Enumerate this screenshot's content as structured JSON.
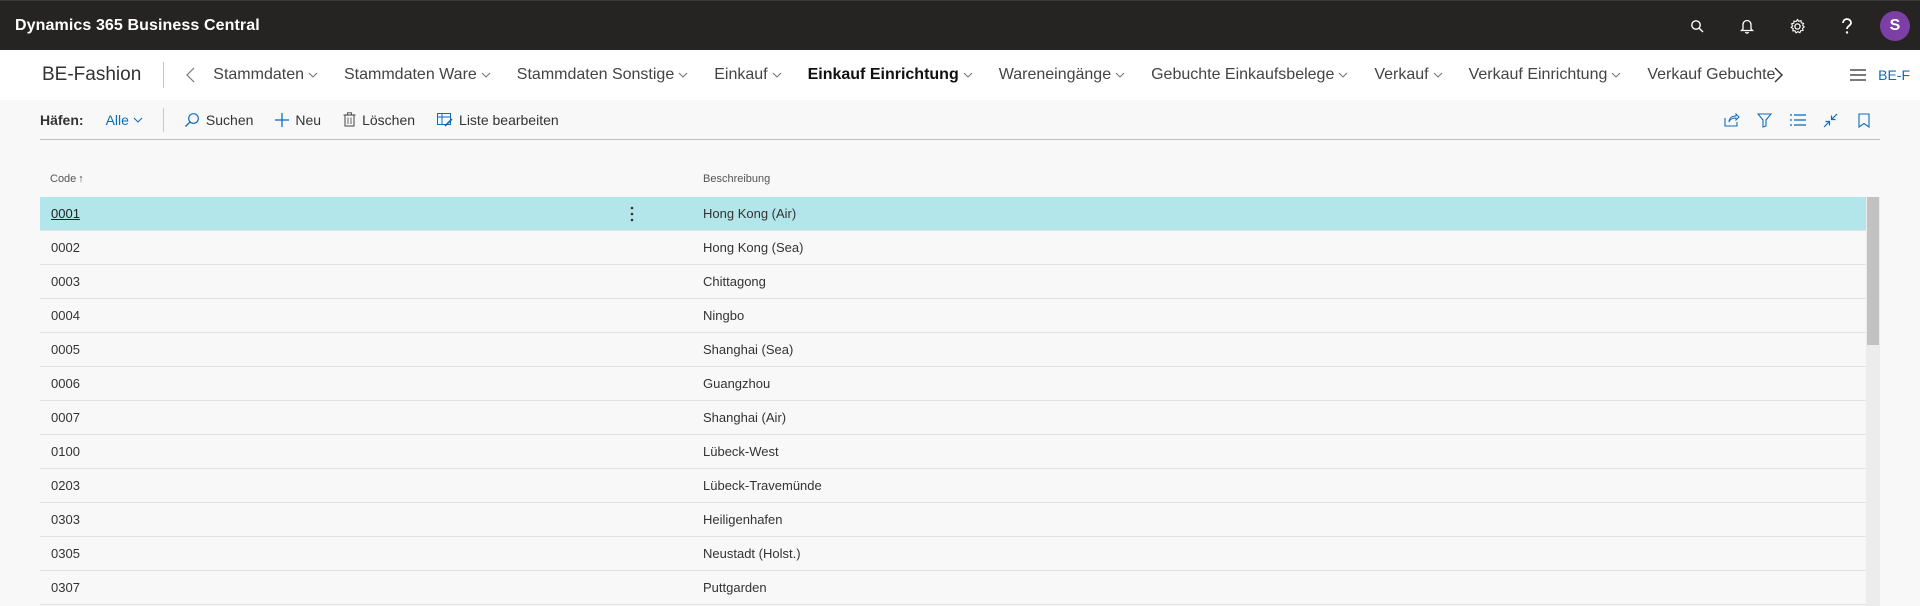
{
  "app": {
    "title": "Dynamics 365 Business Central",
    "user_initial": "S",
    "icons": [
      "search-icon",
      "bell-icon",
      "gear-icon",
      "help-icon"
    ]
  },
  "nav": {
    "company": "BE-Fashion",
    "items": [
      {
        "label": "Stammdaten"
      },
      {
        "label": "Stammdaten Ware"
      },
      {
        "label": "Stammdaten Sonstige"
      },
      {
        "label": "Einkauf"
      },
      {
        "label": "Einkauf Einrichtung",
        "active": true
      },
      {
        "label": "Wareneingänge"
      },
      {
        "label": "Gebuchte Einkaufsbelege"
      },
      {
        "label": "Verkauf"
      },
      {
        "label": "Verkauf Einrichtung"
      },
      {
        "label": "Verkauf Gebuchte"
      }
    ],
    "role_label": "BE-F"
  },
  "actionbar": {
    "caption": "Häfen:",
    "filter": "Alle",
    "actions": {
      "search": "Suchen",
      "new": "Neu",
      "delete": "Löschen",
      "edit_list": "Liste bearbeiten"
    }
  },
  "grid": {
    "columns": {
      "code": "Code",
      "description": "Beschreibung"
    },
    "sort_indicator": "↑",
    "rows": [
      {
        "code": "0001",
        "description": "Hong Kong (Air)",
        "selected": true
      },
      {
        "code": "0002",
        "description": "Hong Kong (Sea)"
      },
      {
        "code": "0003",
        "description": "Chittagong"
      },
      {
        "code": "0004",
        "description": "Ningbo"
      },
      {
        "code": "0005",
        "description": "Shanghai (Sea)"
      },
      {
        "code": "0006",
        "description": "Guangzhou"
      },
      {
        "code": "0007",
        "description": "Shanghai (Air)"
      },
      {
        "code": "0100",
        "description": "Lübeck-West"
      },
      {
        "code": "0203",
        "description": "Lübeck-Travemünde"
      },
      {
        "code": "0303",
        "description": "Heiligenhafen"
      },
      {
        "code": "0305",
        "description": "Neustadt (Holst.)"
      },
      {
        "code": "0307",
        "description": "Puttgarden"
      }
    ]
  },
  "colors": {
    "appbar": "#252423",
    "accent": "#0f6cbd",
    "selected_row": "#b3e6ea",
    "avatar": "#7b3fa6"
  }
}
